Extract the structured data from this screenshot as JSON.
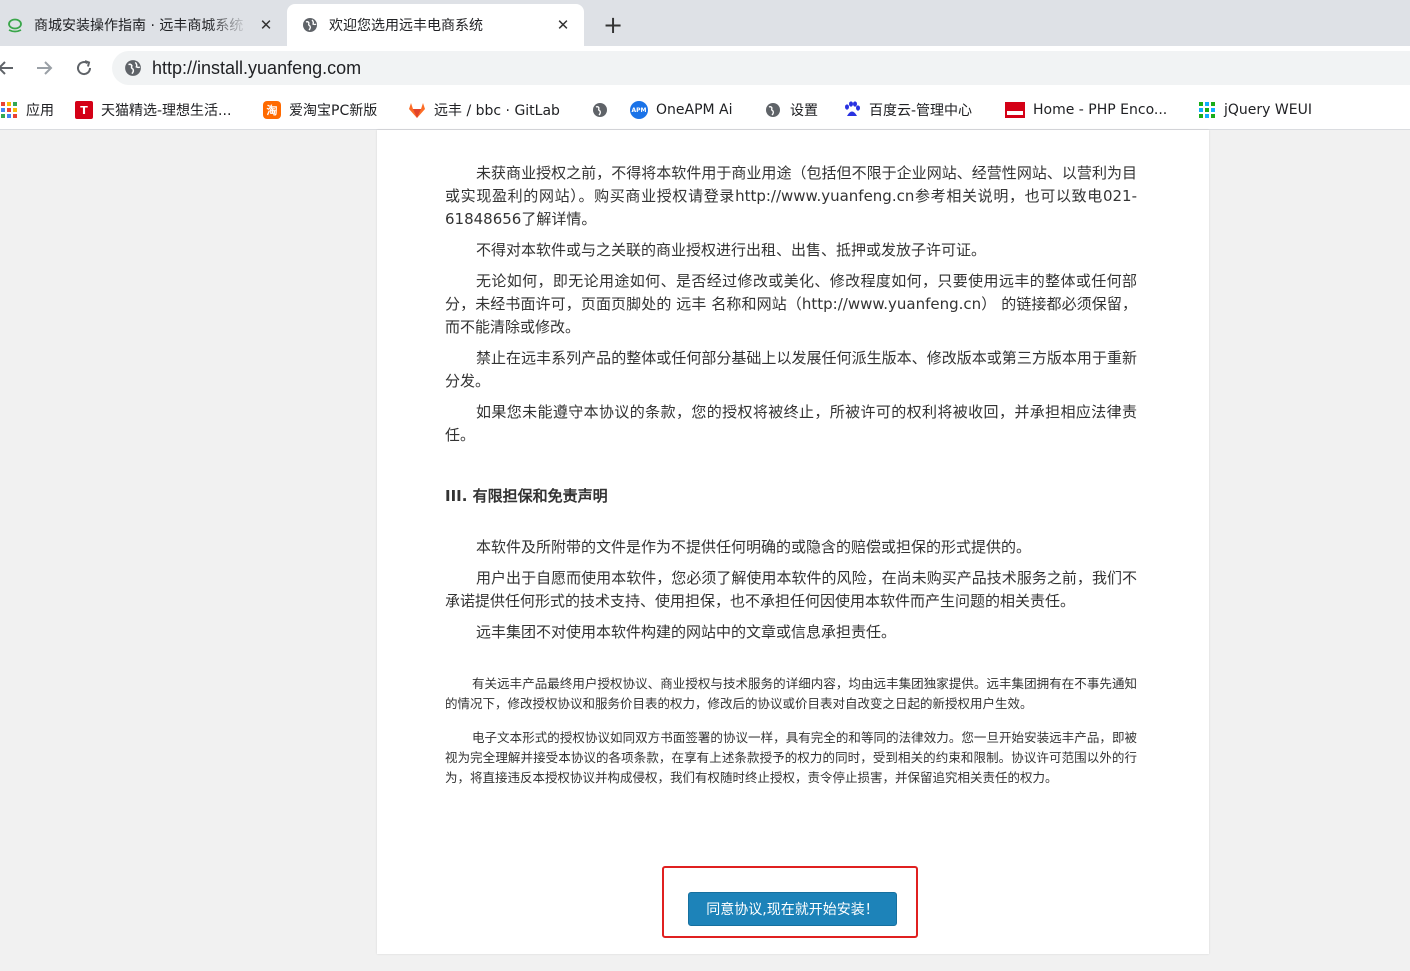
{
  "browser": {
    "tabs": [
      {
        "title": "商城安装操作指南 · 远丰商城系统",
        "favicon": "cloud-icon",
        "active": false
      },
      {
        "title": "欢迎您选用远丰电商系统",
        "favicon": "globe-icon",
        "active": true
      }
    ],
    "new_tab_label": "+",
    "url": "http://install.yuanfeng.com",
    "bookmarks": [
      {
        "label": "应用",
        "icon": "apps-grid-icon"
      },
      {
        "label": "天猫精选-理想生活...",
        "icon": "tmall-icon",
        "glyph": "T"
      },
      {
        "label": "爱淘宝PC新版",
        "icon": "taobao-icon",
        "glyph": "淘"
      },
      {
        "label": "远丰 / bbc · GitLab",
        "icon": "gitlab-icon"
      },
      {
        "label": "",
        "icon": "globe-icon"
      },
      {
        "label": "OneAPM Ai",
        "icon": "oneapm-icon"
      },
      {
        "label": "设置",
        "icon": "globe-icon"
      },
      {
        "label": "百度云-管理中心",
        "icon": "baidu-icon"
      },
      {
        "label": "Home - PHP Enco...",
        "icon": "php-encoder-icon"
      },
      {
        "label": "jQuery WEUI",
        "icon": "weui-icon"
      }
    ]
  },
  "license": {
    "paragraphs_a": [
      "未获商业授权之前，不得将本软件用于商业用途（包括但不限于企业网站、经营性网站、以营利为目或实现盈利的网站）。购买商业授权请登录http://www.yuanfeng.cn参考相关说明，也可以致电021-61848656了解详情。",
      "不得对本软件或与之关联的商业授权进行出租、出售、抵押或发放子许可证。",
      "无论如何，即无论用途如何、是否经过修改或美化、修改程度如何，只要使用远丰的整体或任何部分，未经书面许可，页面页脚处的 远丰 名称和网站（http://www.yuanfeng.cn） 的链接都必须保留，而不能清除或修改。",
      "禁止在远丰系列产品的整体或任何部分基础上以发展任何派生版本、修改版本或第三方版本用于重新分发。",
      "如果您未能遵守本协议的条款，您的授权将被终止，所被许可的权利将被收回，并承担相应法律责任。"
    ],
    "section3_title": "III. 有限担保和免责声明",
    "paragraphs_b": [
      "本软件及所附带的文件是作为不提供任何明确的或隐含的赔偿或担保的形式提供的。",
      "用户出于自愿而使用本软件，您必须了解使用本软件的风险，在尚未购买产品技术服务之前，我们不承诺提供任何形式的技术支持、使用担保，也不承担任何因使用本软件而产生问题的相关责任。",
      "远丰集团不对使用本软件构建的网站中的文章或信息承担责任。"
    ],
    "notes": [
      "有关远丰产品最终用户授权协议、商业授权与技术服务的详细内容，均由远丰集团独家提供。远丰集团拥有在不事先通知的情况下，修改授权协议和服务价目表的权力，修改后的协议或价目表对自改变之日起的新授权用户生效。",
      "电子文本形式的授权协议如同双方书面签署的协议一样，具有完全的和等同的法律效力。您一旦开始安装远丰产品，即被视为完全理解并接受本协议的各项条款，在享有上述条款授予的权力的同时，受到相关的约束和限制。协议许可范围以外的行为，将直接违反本授权协议并构成侵权，我们有权随时终止授权，责令停止损害，并保留追究相关责任的权力。"
    ],
    "agree_button": "同意协议,现在就开始安装！"
  },
  "colors": {
    "accent_button": "#1d83b9",
    "highlight_box": "#e02020"
  }
}
